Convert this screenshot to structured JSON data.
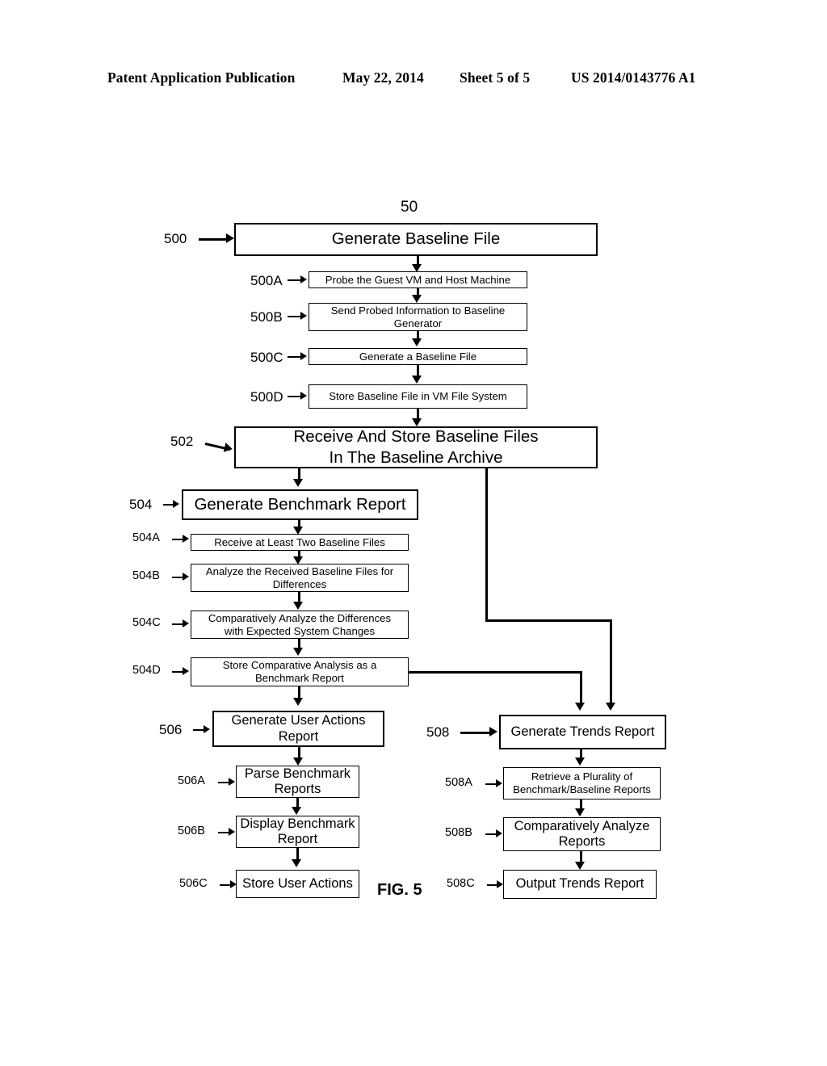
{
  "header": {
    "publication": "Patent Application Publication",
    "date": "May 22, 2014",
    "sheet": "Sheet 5 of 5",
    "patent_number": "US 2014/0143776 A1"
  },
  "figure": {
    "caption": "FIG. 5",
    "system_numeral": "50"
  },
  "nodes": [
    {
      "id": "500",
      "numeral": "500",
      "label": "Generate Baseline File"
    },
    {
      "id": "500A",
      "numeral": "500A",
      "label": "Probe the Guest VM and Host Machine"
    },
    {
      "id": "500B",
      "numeral": "500B",
      "label": "Send Probed Information to Baseline Generator"
    },
    {
      "id": "500C",
      "numeral": "500C",
      "label": "Generate a Baseline File"
    },
    {
      "id": "500D",
      "numeral": "500D",
      "label": "Store Baseline File in VM File System"
    },
    {
      "id": "502",
      "numeral": "502",
      "label": "Receive And Store Baseline Files In The Baseline Archive"
    },
    {
      "id": "504",
      "numeral": "504",
      "label": "Generate Benchmark Report"
    },
    {
      "id": "504A",
      "numeral": "504A",
      "label": "Receive at Least Two Baseline Files"
    },
    {
      "id": "504B",
      "numeral": "504B",
      "label": "Analyze the Received Baseline Files for Differences"
    },
    {
      "id": "504C",
      "numeral": "504C",
      "label": "Comparatively Analyze the Differences with Expected System Changes"
    },
    {
      "id": "504D",
      "numeral": "504D",
      "label": "Store Comparative Analysis as a Benchmark Report"
    },
    {
      "id": "506",
      "numeral": "506",
      "label": "Generate User Actions Report"
    },
    {
      "id": "506A",
      "numeral": "506A",
      "label": "Parse Benchmark Reports"
    },
    {
      "id": "506B",
      "numeral": "506B",
      "label": "Display Benchmark Report"
    },
    {
      "id": "506C",
      "numeral": "506C",
      "label": "Store User Actions"
    },
    {
      "id": "508",
      "numeral": "508",
      "label": "Generate Trends Report"
    },
    {
      "id": "508A",
      "numeral": "508A",
      "label": "Retrieve a Plurality of Benchmark/Baseline Reports"
    },
    {
      "id": "508B",
      "numeral": "508B",
      "label": "Comparatively Analyze Reports"
    },
    {
      "id": "508C",
      "numeral": "508C",
      "label": "Output Trends Report"
    }
  ],
  "node_text": {
    "n500": "Generate Baseline File",
    "n500A": "Probe the Guest VM and Host Machine",
    "n500B_l1": "Send Probed Information to Baseline",
    "n500B_l2": "Generator",
    "n500C": "Generate a Baseline File",
    "n500D": "Store Baseline File in VM File System",
    "n502_l1": "Receive And Store Baseline Files",
    "n502_l2": "In The Baseline Archive",
    "n504": "Generate Benchmark Report",
    "n504A": "Receive at Least Two Baseline Files",
    "n504B_l1": "Analyze the Received Baseline Files for",
    "n504B_l2": "Differences",
    "n504C_l1": "Comparatively Analyze the Differences",
    "n504C_l2": "with Expected System Changes",
    "n504D_l1": "Store Comparative Analysis as a",
    "n504D_l2": "Benchmark Report",
    "n506_l1": "Generate User Actions",
    "n506_l2": "Report",
    "n506A_l1": "Parse Benchmark",
    "n506A_l2": "Reports",
    "n506B_l1": "Display Benchmark",
    "n506B_l2": "Report",
    "n506C": "Store User Actions",
    "n508": "Generate Trends Report",
    "n508A_l1": "Retrieve a Plurality of",
    "n508A_l2": "Benchmark/Baseline Reports",
    "n508B_l1": "Comparatively Analyze",
    "n508B_l2": "Reports",
    "n508C": "Output Trends Report"
  },
  "numerals": {
    "r50": "50",
    "r500": "500",
    "r500A": "500A",
    "r500B": "500B",
    "r500C": "500C",
    "r500D": "500D",
    "r502": "502",
    "r504": "504",
    "r504A": "504A",
    "r504B": "504B",
    "r504C": "504C",
    "r504D": "504D",
    "r506": "506",
    "r506A": "506A",
    "r506B": "506B",
    "r506C": "506C",
    "r508": "508",
    "r508A": "508A",
    "r508B": "508B",
    "r508C": "508C"
  },
  "colors": {
    "ink": "#000000",
    "paper": "#ffffff"
  }
}
